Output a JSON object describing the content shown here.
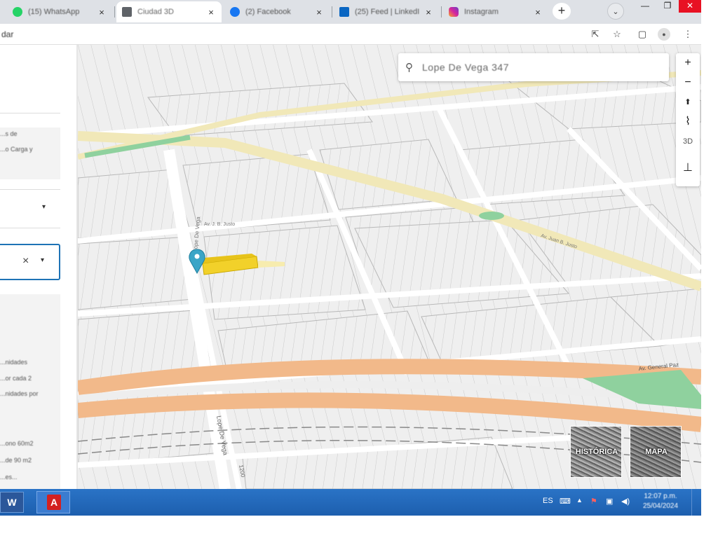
{
  "browser": {
    "tabs": [
      {
        "label": "(15) WhatsApp",
        "icon": "whatsapp-icon",
        "color": "#25d366",
        "active": false
      },
      {
        "label": "Ciudad 3D",
        "icon": "document-icon",
        "color": "#5f6368",
        "active": true
      },
      {
        "label": "(2) Facebook",
        "icon": "facebook-icon",
        "color": "#1877f2",
        "active": false
      },
      {
        "label": "(25) Feed | LinkedIn",
        "icon": "linkedin-icon",
        "color": "#0a66c2",
        "active": false
      },
      {
        "label": "Instagram",
        "icon": "instagram-icon",
        "color": "#d6249f",
        "active": false
      }
    ],
    "close_glyph": "×",
    "new_tab_glyph": "+",
    "tab_search_glyph": "⌄",
    "window_controls": {
      "minimize": "—",
      "maximize": "❐",
      "close": "✕"
    },
    "url_fragment": "dar",
    "toolbar_icons": {
      "share": "⇱",
      "bookmark": "☆",
      "sidepanel": "▢",
      "profile": "●",
      "menu": "⋮"
    }
  },
  "sidebar": {
    "card1_lines": [
      "...s de",
      "...o Carga y"
    ],
    "select1_arrow": "▾",
    "select2_clear": "×",
    "select2_arrow": "▾",
    "card2_lines": [
      "...nidades",
      "...or cada 2",
      "...nidades por",
      "...ono 60m2",
      "...de 90 m2",
      "...es..."
    ]
  },
  "map": {
    "search": {
      "icon": "⚲",
      "value": "Lope De Vega 347"
    },
    "controls": {
      "zoom_in": "+",
      "zoom_out": "−",
      "compass": "⬆",
      "terrain": "⌇",
      "mode_3d": "3D",
      "measure": "⊥"
    },
    "street_labels": [
      "Lope De Vega",
      "Lope De Vega",
      "Av. J. B. Justo",
      "Av. Juan B. Justo",
      "Av. General Paz",
      "1200"
    ],
    "thumbnails": [
      {
        "label": "HISTÓRICA"
      },
      {
        "label": "MAPA"
      }
    ],
    "marker_color": "#3aa5c7",
    "highlight_color": "#f2d12a",
    "avenue_color": "#f1e8b8",
    "highway_color": "#f2b98a"
  },
  "taskbar": {
    "word_label": "W",
    "pdf_label": "A",
    "language": "ES",
    "tray_icons": [
      "▲",
      "⚑",
      "▣",
      "◀)"
    ],
    "time": "12:07 p.m.",
    "date": "25/04/2024"
  }
}
